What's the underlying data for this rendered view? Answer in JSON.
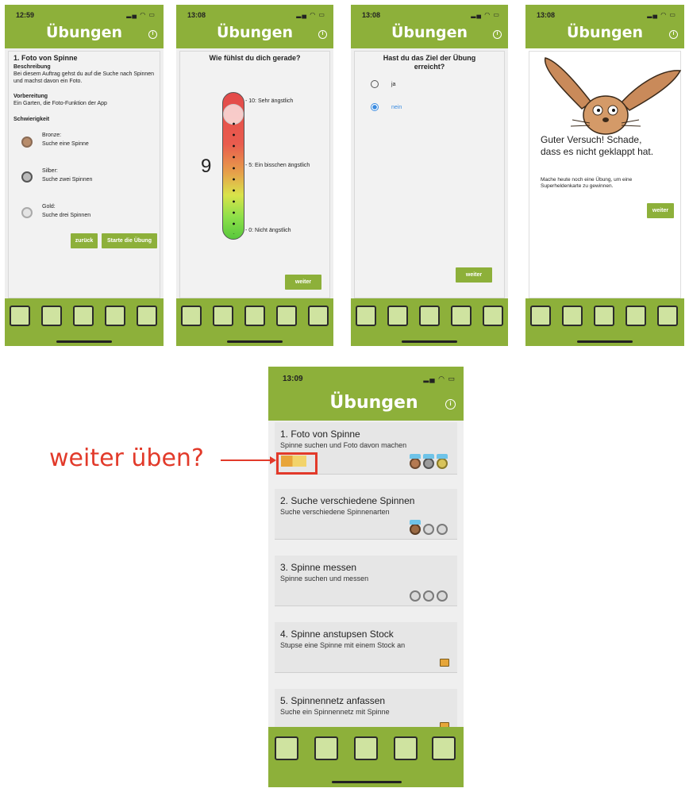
{
  "screens": {
    "s1": {
      "time": "12:59",
      "title": "Übungen",
      "heading": "1. Foto von Spinne",
      "beschreibung_label": "Beschreibung",
      "beschreibung_text": "Bei diesem Auftrag gehst du auf die Suche nach Spinnen und machst davon ein Foto.",
      "vorbereitung_label": "Vorbereitung",
      "vorbereitung_text": "Ein Garten, die Foto-Funktion der App",
      "schwierigkeit_label": "Schwierigkeit",
      "levels": [
        {
          "name": "Bronze:",
          "desc": "Suche eine Spinne"
        },
        {
          "name": "Silber:",
          "desc": "Suche zwei Spinnen"
        },
        {
          "name": "Gold:",
          "desc": "Suche drei Spinnen"
        }
      ],
      "back_btn": "zurück",
      "start_btn": "Starte die Übung"
    },
    "s2": {
      "time": "13:08",
      "title": "Übungen",
      "question": "Wie fühlst du dich gerade?",
      "value": "9",
      "scale_labels": [
        "- 10: Sehr ängstlich",
        "- 5: Ein bisschen ängstlich",
        "- 0: Nicht ängstlich"
      ],
      "next_btn": "weiter"
    },
    "s3": {
      "time": "13:08",
      "title": "Übungen",
      "question": "Hast du das Ziel der Übung erreicht?",
      "options": [
        "ja",
        "nein"
      ],
      "selected": "nein",
      "next_btn": "weiter"
    },
    "s4": {
      "time": "13:08",
      "title": "Übungen",
      "message": "Guter Versuch! Schade, dass es nicht geklappt hat.",
      "sub": "Mache heute noch eine Übung, um eine Superheldenkarte zu gewinnen.",
      "next_btn": "weiter"
    },
    "s5": {
      "time": "13:09",
      "title": "Übungen",
      "exercises": [
        {
          "title": "1. Foto von Spinne",
          "sub": "Spinne suchen und Foto davon machen"
        },
        {
          "title": "2. Suche verschiedene Spinnen",
          "sub": "Suche verschiedene Spinnenarten"
        },
        {
          "title": "3. Spinne messen",
          "sub": "Spinne suchen und messen"
        },
        {
          "title": "4. Spinne anstupsen Stock",
          "sub": "Stupse eine Spinne mit einem Stock an"
        },
        {
          "title": "5. Spinnennetz anfassen",
          "sub": "Suche ein Spinnennetz mit Spinne"
        }
      ]
    }
  },
  "annotation": "weiter üben?",
  "colors": {
    "green": "#8db03a",
    "annotation": "#e23a2a",
    "radio": "#3a8be0"
  },
  "icons": [
    "person-at-desk-icon",
    "checklist-icon",
    "camera-photo-icon",
    "framed-card-icon",
    "market-stall-icon"
  ]
}
